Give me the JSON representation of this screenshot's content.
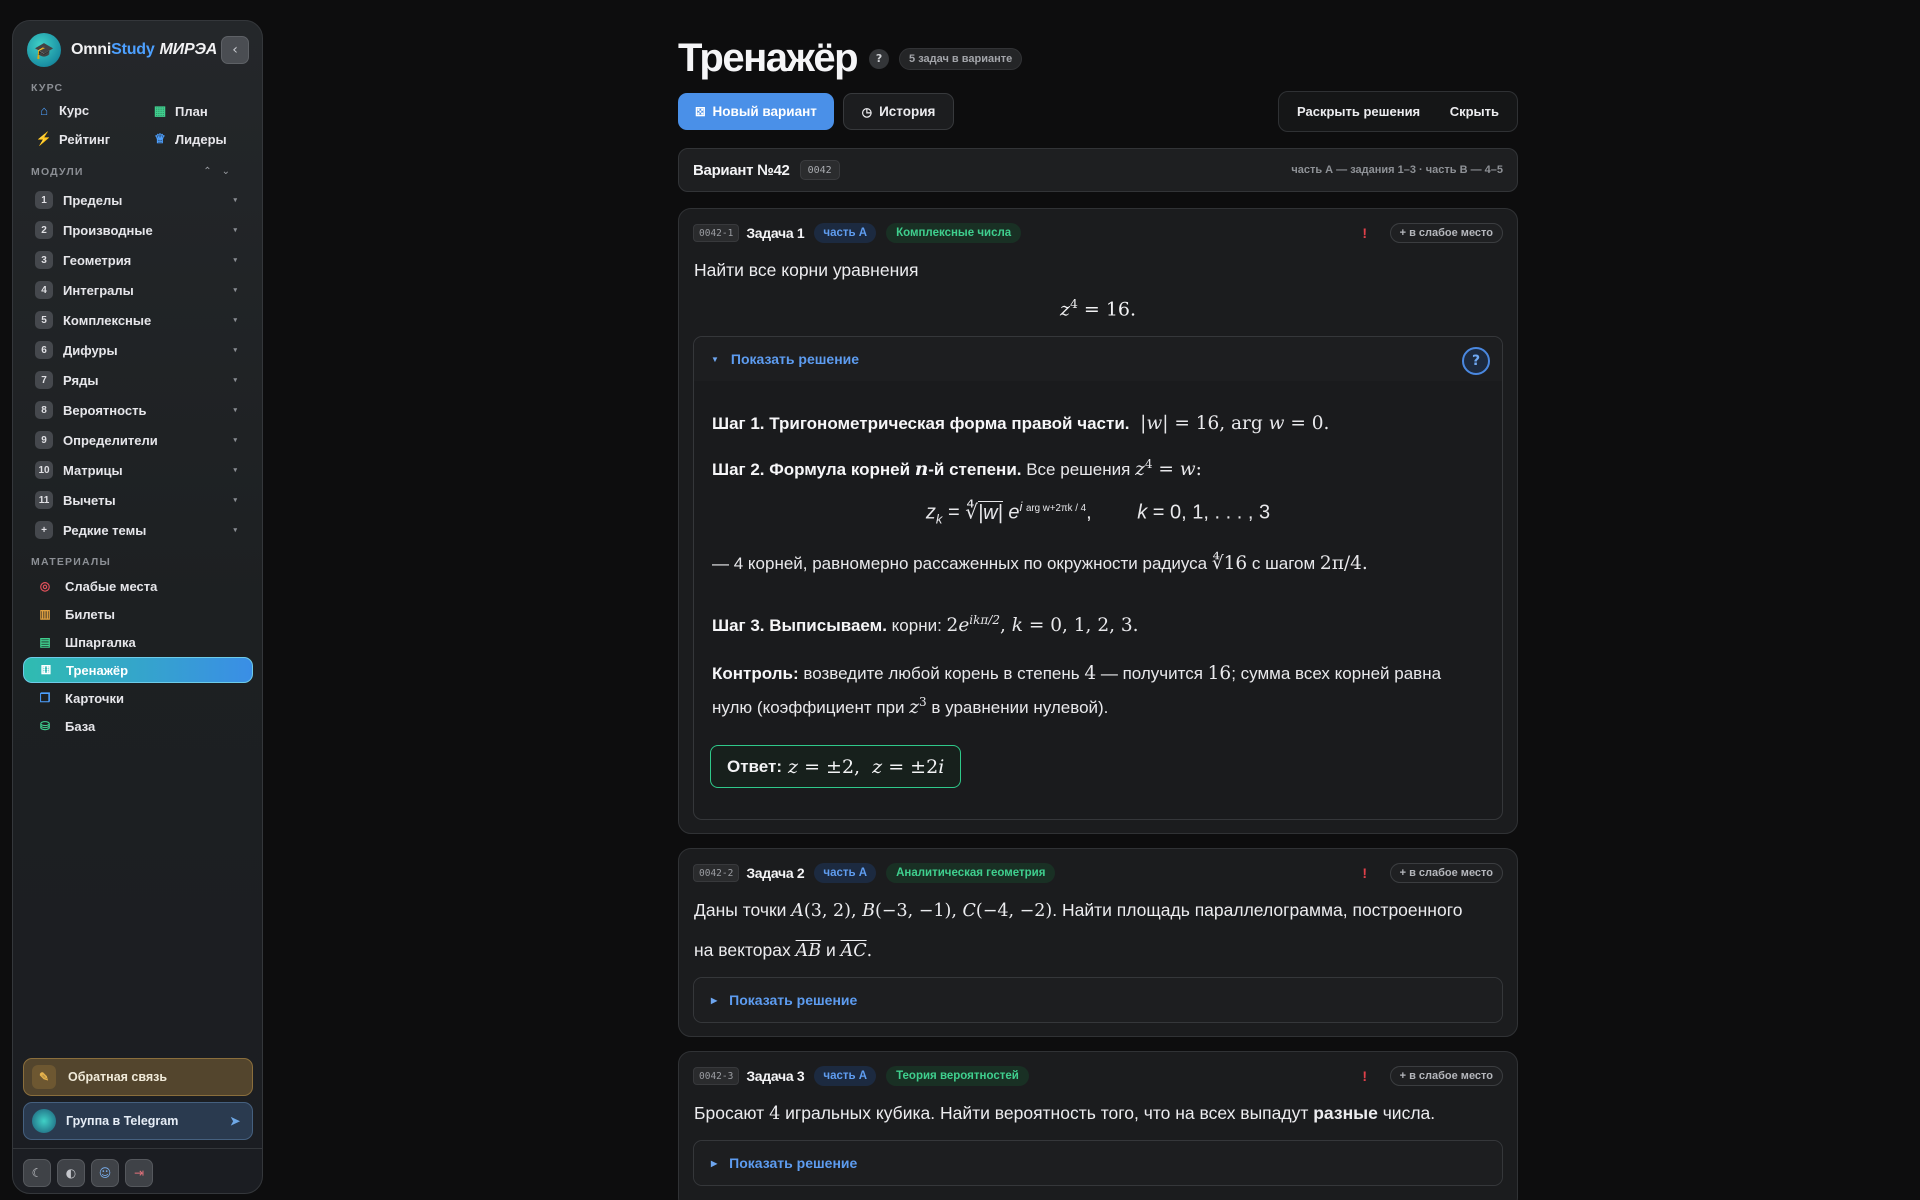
{
  "sidebar": {
    "brand": {
      "part1": "Omni",
      "part2": "Study",
      "part3": "МИРЭА"
    },
    "course_label": "КУРС",
    "course_items": [
      {
        "label": "Курс",
        "icon": "home-icon"
      },
      {
        "label": "План",
        "icon": "map-icon"
      },
      {
        "label": "Рейтинг",
        "icon": "bolt-icon"
      },
      {
        "label": "Лидеры",
        "icon": "trophy-icon"
      }
    ],
    "modules_label": "МОДУЛИ",
    "modules": [
      {
        "num": "1",
        "label": "Пределы"
      },
      {
        "num": "2",
        "label": "Производные"
      },
      {
        "num": "3",
        "label": "Геометрия"
      },
      {
        "num": "4",
        "label": "Интегралы"
      },
      {
        "num": "5",
        "label": "Комплексные"
      },
      {
        "num": "6",
        "label": "Дифуры"
      },
      {
        "num": "7",
        "label": "Ряды"
      },
      {
        "num": "8",
        "label": "Вероятность"
      },
      {
        "num": "9",
        "label": "Определители"
      },
      {
        "num": "10",
        "label": "Матрицы"
      },
      {
        "num": "11",
        "label": "Вычеты"
      },
      {
        "num": "+",
        "label": "Редкие темы"
      }
    ],
    "materials_label": "МАТЕРИАЛЫ",
    "materials": [
      {
        "label": "Слабые места",
        "icon": "target-icon",
        "color": "#e0505a"
      },
      {
        "label": "Билеты",
        "icon": "book-icon",
        "color": "#e0a040"
      },
      {
        "label": "Шпаргалка",
        "icon": "note-icon",
        "color": "#3fcf8e"
      },
      {
        "label": "Тренажёр",
        "icon": "dice-icon",
        "color": "#ffffff"
      },
      {
        "label": "Карточки",
        "icon": "cards-icon",
        "color": "#4da0ff"
      },
      {
        "label": "База",
        "icon": "database-icon",
        "color": "#3fcf8e"
      }
    ],
    "feedback_label": "Обратная связь",
    "telegram_label": "Группа в Telegram"
  },
  "header": {
    "title": "Тренажёр",
    "help": "?",
    "tasks_count": "5 задач в варианте",
    "new_variant": "Новый вариант",
    "history": "История",
    "reveal": "Раскрыть решения",
    "hide": "Скрыть"
  },
  "variant": {
    "title": "Вариант №42",
    "code": "0042",
    "note": "часть А — задания 1–3 · часть В — 4–5"
  },
  "tasks": [
    {
      "code": "0042-1",
      "title": "Задача 1",
      "part": "часть А",
      "topic": "Комплексные числа",
      "warn": "!",
      "weak": "+ в слабое место",
      "text": "Найти все корни уравнения",
      "solution_toggle": "Показать решение",
      "step1_title": "Шаг 1. Тригонометрическая форма правой части.",
      "step2_title_a": "Шаг 2. Формула корней ",
      "step2_title_b": "-й степени.",
      "step2_text": " Все решения ",
      "step2_note_a": "— 4 корней, равномерно рассаженных по окружности радиуса ",
      "step2_note_b": " с шагом ",
      "step3_title": "Шаг 3. Выписываем.",
      "step3_text": " корни: ",
      "control_title": "Контроль:",
      "control_text_a": " возведите любой корень в степень ",
      "control_text_b": " — получится ",
      "control_text_c": "; сумма всех корней равна",
      "control_text_d": "нулю (коэффициент при ",
      "control_text_e": " в уравнении нулевой).",
      "answer_label": "Ответ:"
    },
    {
      "code": "0042-2",
      "title": "Задача 2",
      "part": "часть А",
      "topic": "Аналитическая геометрия",
      "warn": "!",
      "weak": "+ в слабое место",
      "text_a": "Даны точки ",
      "text_b": ". Найти площадь параллелограмма, построенного",
      "text_c": "на векторах ",
      "text_d": " и ",
      "solution_toggle": "Показать решение"
    },
    {
      "code": "0042-3",
      "title": "Задача 3",
      "part": "часть А",
      "topic": "Теория вероятностей",
      "warn": "!",
      "weak": "+ в слабое место",
      "text_a": "Бросают ",
      "text_b": " игральных кубика. Найти вероятность того, что на всех выпадут ",
      "text_bold": "разные",
      "text_c": " числа.",
      "solution_toggle": "Показать решение"
    }
  ],
  "colors": {
    "accent": "#4a90e8",
    "active_gradient_start": "#2fbcb0",
    "active_gradient_end": "#3a8ee6",
    "topic_green": "#3fcf8e",
    "warn_red": "#e0404a"
  }
}
